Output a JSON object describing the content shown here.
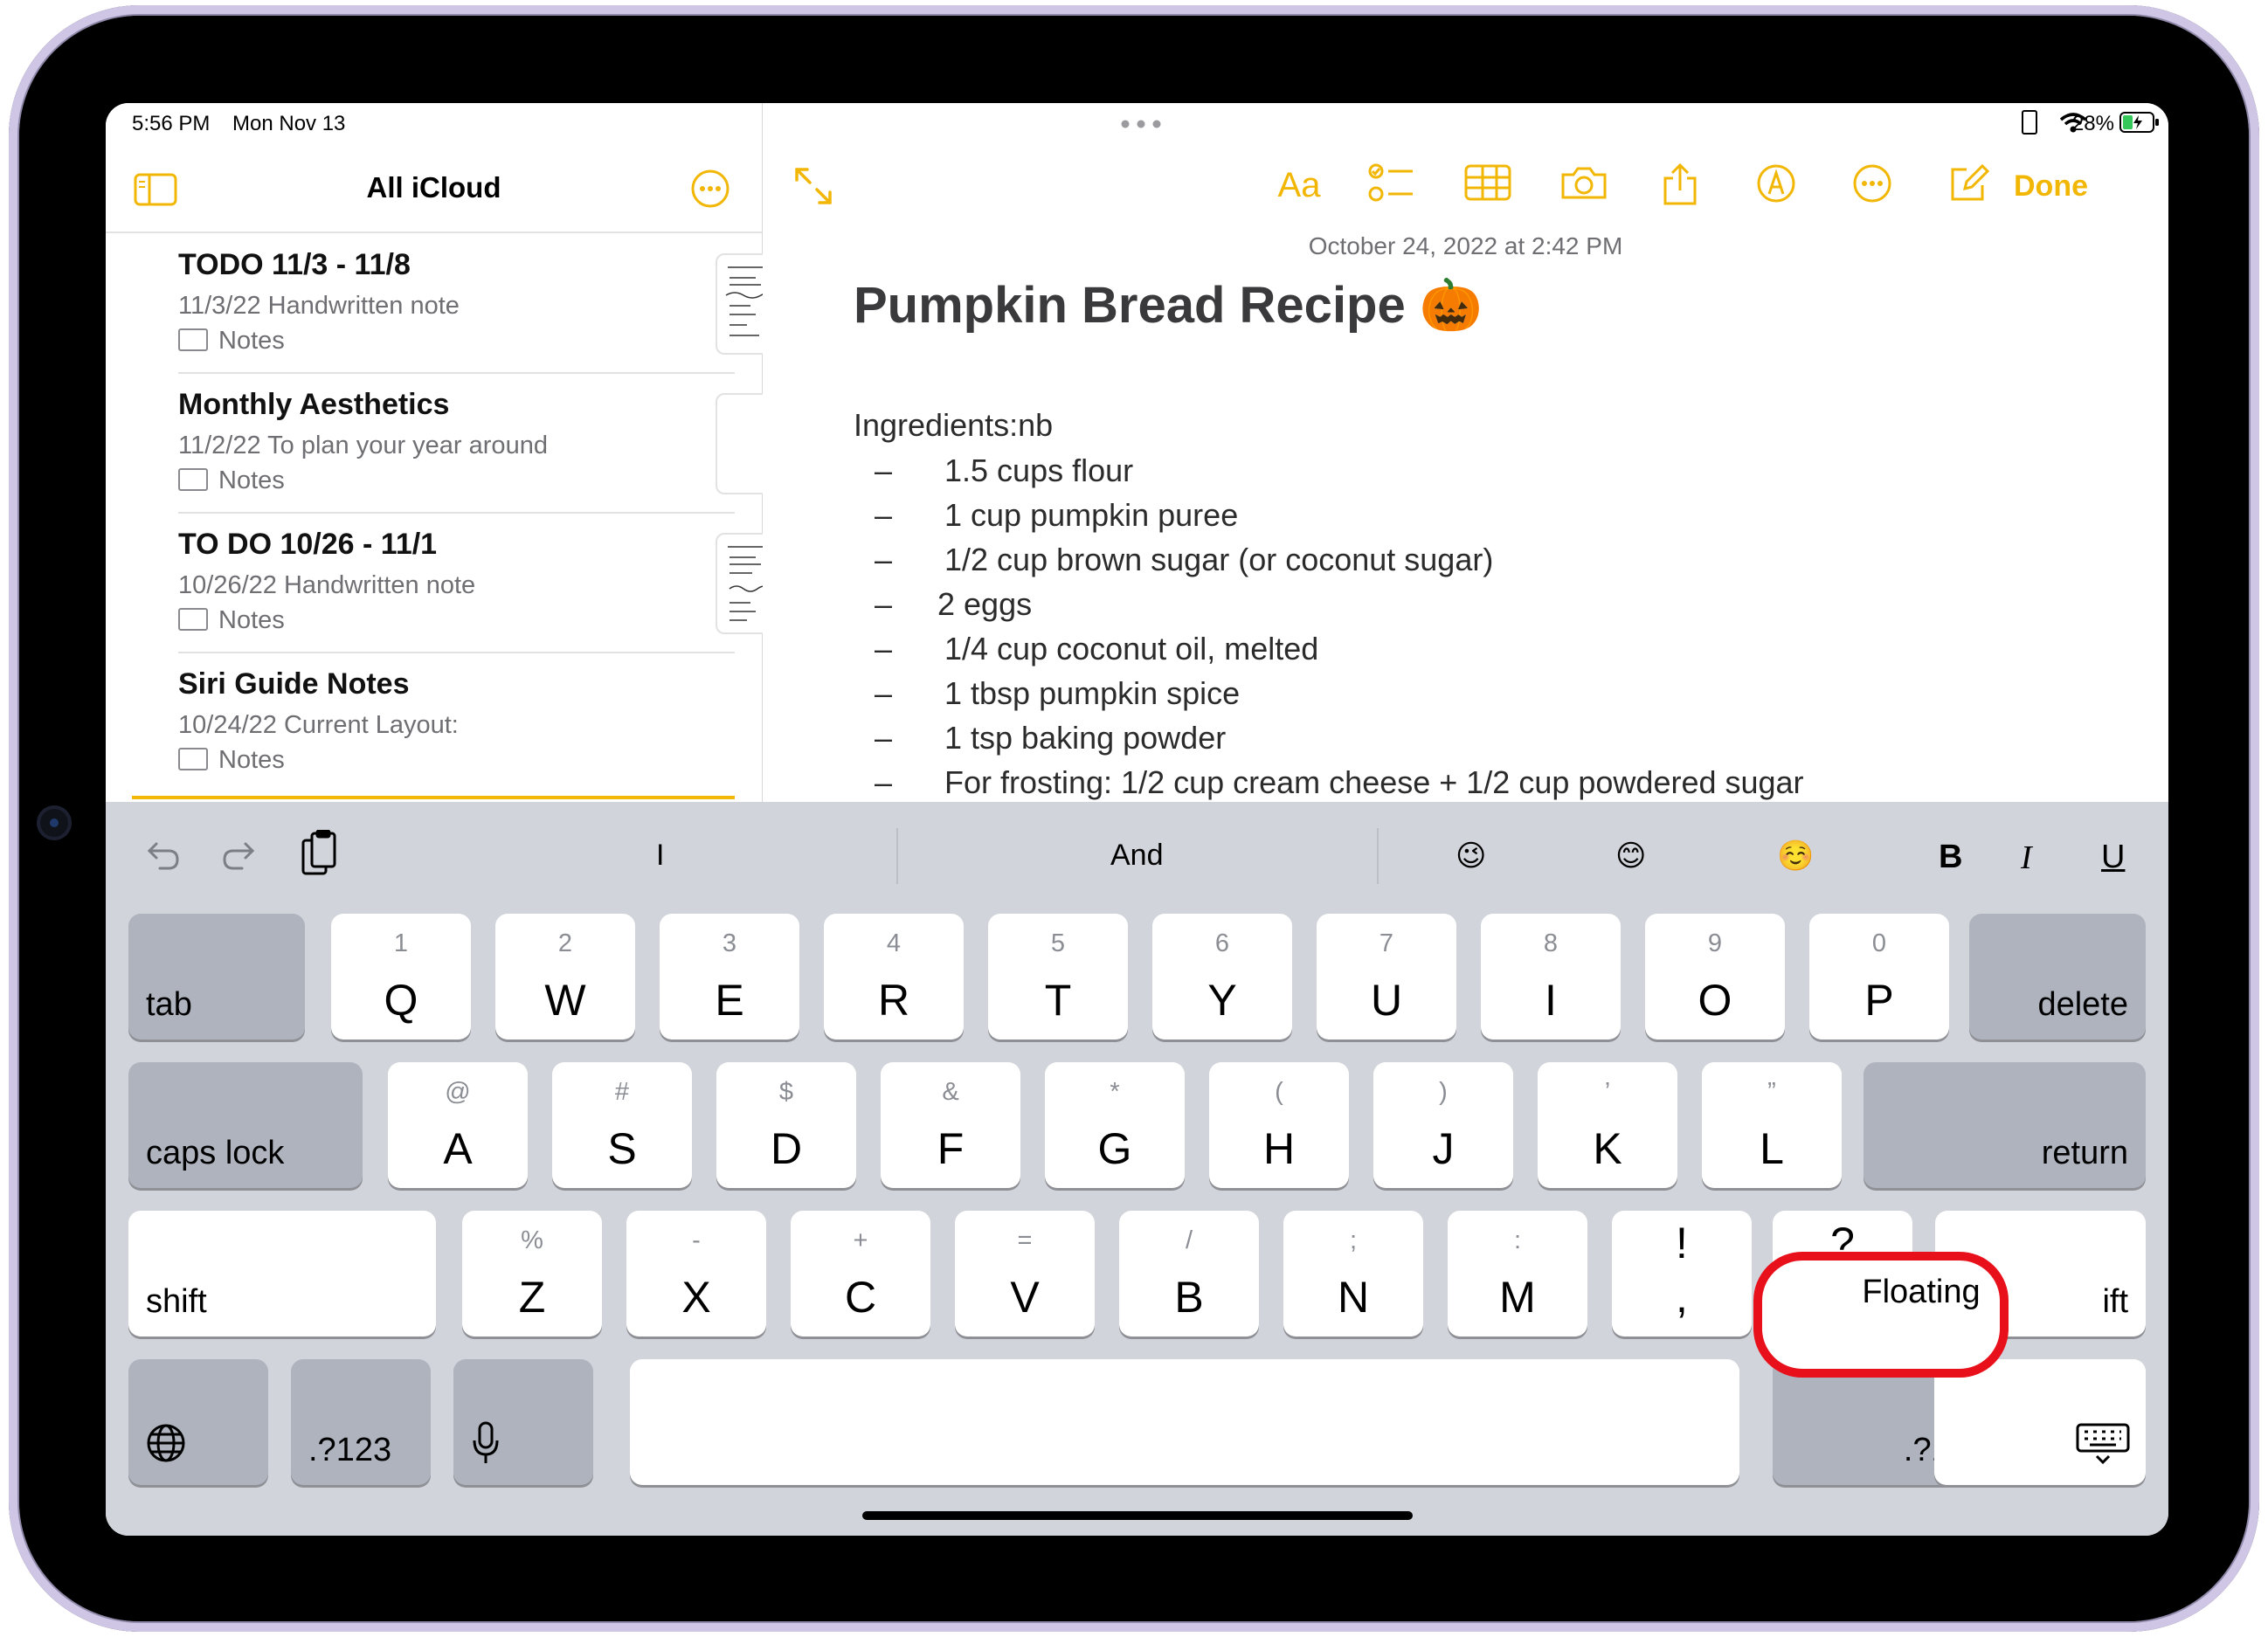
{
  "status": {
    "time": "5:56 PM",
    "date": "Mon Nov 13",
    "battery": "28%"
  },
  "sidebar": {
    "title": "All iCloud",
    "notes": [
      {
        "title": "TODO 11/3 - 11/8",
        "meta": "11/3/22  Handwritten note",
        "folder": "Notes"
      },
      {
        "title": "Monthly Aesthetics",
        "meta": "11/2/22  To plan your year around",
        "folder": "Notes"
      },
      {
        "title": "TO DO 10/26 - 11/1",
        "meta": "10/26/22  Handwritten note",
        "folder": "Notes"
      },
      {
        "title": "Siri Guide Notes",
        "meta": "10/24/22  Current Layout:",
        "folder": "Notes"
      }
    ]
  },
  "editor": {
    "toolbar": {
      "format": "Aa",
      "done": "Done"
    },
    "timestamp": "October 24, 2022 at 2:42 PM",
    "title": "Pumpkin Bread Recipe 🎃",
    "ingredients_label": "Ingredients:nb",
    "items": [
      "1.5 cups flour",
      "1 cup pumpkin puree",
      "1/2 cup brown sugar (or coconut sugar)",
      "2 eggs",
      "1/4 cup coconut oil, melted",
      "1 tbsp pumpkin spice",
      "1 tsp baking powder",
      "For frosting: 1/2 cup cream cheese + 1/2 cup powdered sugar"
    ],
    "bullet": "–"
  },
  "suggestions": {
    "left": "I",
    "center": "And",
    "emoji1": "😉",
    "emoji2": "😊",
    "emoji3": "☺️",
    "bold": "B",
    "italic": "I",
    "underline": "U"
  },
  "keyboard": {
    "row1": [
      {
        "main": "Q",
        "sub": "1"
      },
      {
        "main": "W",
        "sub": "2"
      },
      {
        "main": "E",
        "sub": "3"
      },
      {
        "main": "R",
        "sub": "4"
      },
      {
        "main": "T",
        "sub": "5"
      },
      {
        "main": "Y",
        "sub": "6"
      },
      {
        "main": "U",
        "sub": "7"
      },
      {
        "main": "I",
        "sub": "8"
      },
      {
        "main": "O",
        "sub": "9"
      },
      {
        "main": "P",
        "sub": "0"
      }
    ],
    "row2": [
      {
        "main": "A",
        "sub": "@"
      },
      {
        "main": "S",
        "sub": "#"
      },
      {
        "main": "D",
        "sub": "$"
      },
      {
        "main": "F",
        "sub": "&"
      },
      {
        "main": "G",
        "sub": "*"
      },
      {
        "main": "H",
        "sub": "("
      },
      {
        "main": "J",
        "sub": ")"
      },
      {
        "main": "K",
        "sub": "’"
      },
      {
        "main": "L",
        "sub": "”"
      }
    ],
    "row3": [
      {
        "main": "Z",
        "sub": "%"
      },
      {
        "main": "X",
        "sub": "-"
      },
      {
        "main": "C",
        "sub": "+"
      },
      {
        "main": "V",
        "sub": "="
      },
      {
        "main": "B",
        "sub": "/"
      },
      {
        "main": "N",
        "sub": ";"
      },
      {
        "main": "M",
        "sub": ":"
      },
      {
        "main": ",",
        "sub": "!"
      }
    ],
    "tab": "tab",
    "delete": "delete",
    "caps_lock": "caps lock",
    "return": "return",
    "shift": "shift",
    "shift_right_fragment": "ift",
    "question_fragment": "?",
    "numbers_left": ".?123",
    "numbers_right": ".?123",
    "floating": "Floating"
  },
  "colors": {
    "accent": "#f2b705",
    "highlight": "#e8101a",
    "keyboard_bg": "#d1d4da",
    "key_dark": "#aeb3be"
  }
}
